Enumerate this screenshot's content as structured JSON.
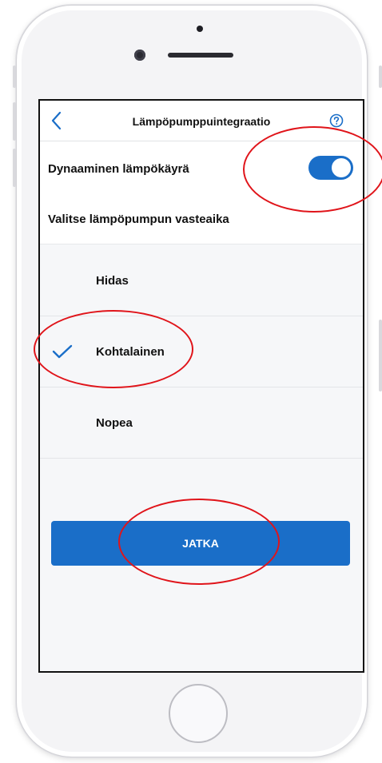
{
  "header": {
    "title": "Lämpöpumppuintegraatio"
  },
  "toggle_row": {
    "label": "Dynaaminen lämpökäyrä",
    "enabled": true
  },
  "section": {
    "label": "Valitse lämpöpumpun vasteaika"
  },
  "options": [
    {
      "label": "Hidas",
      "selected": false
    },
    {
      "label": "Kohtalainen",
      "selected": true
    },
    {
      "label": "Nopea",
      "selected": false
    }
  ],
  "continue_button": {
    "label": "JATKA"
  },
  "colors": {
    "accent": "#1a6ec8",
    "annotation": "#e0141a"
  },
  "icons": [
    "back-chevron-icon",
    "help-icon",
    "checkmark-icon"
  ]
}
